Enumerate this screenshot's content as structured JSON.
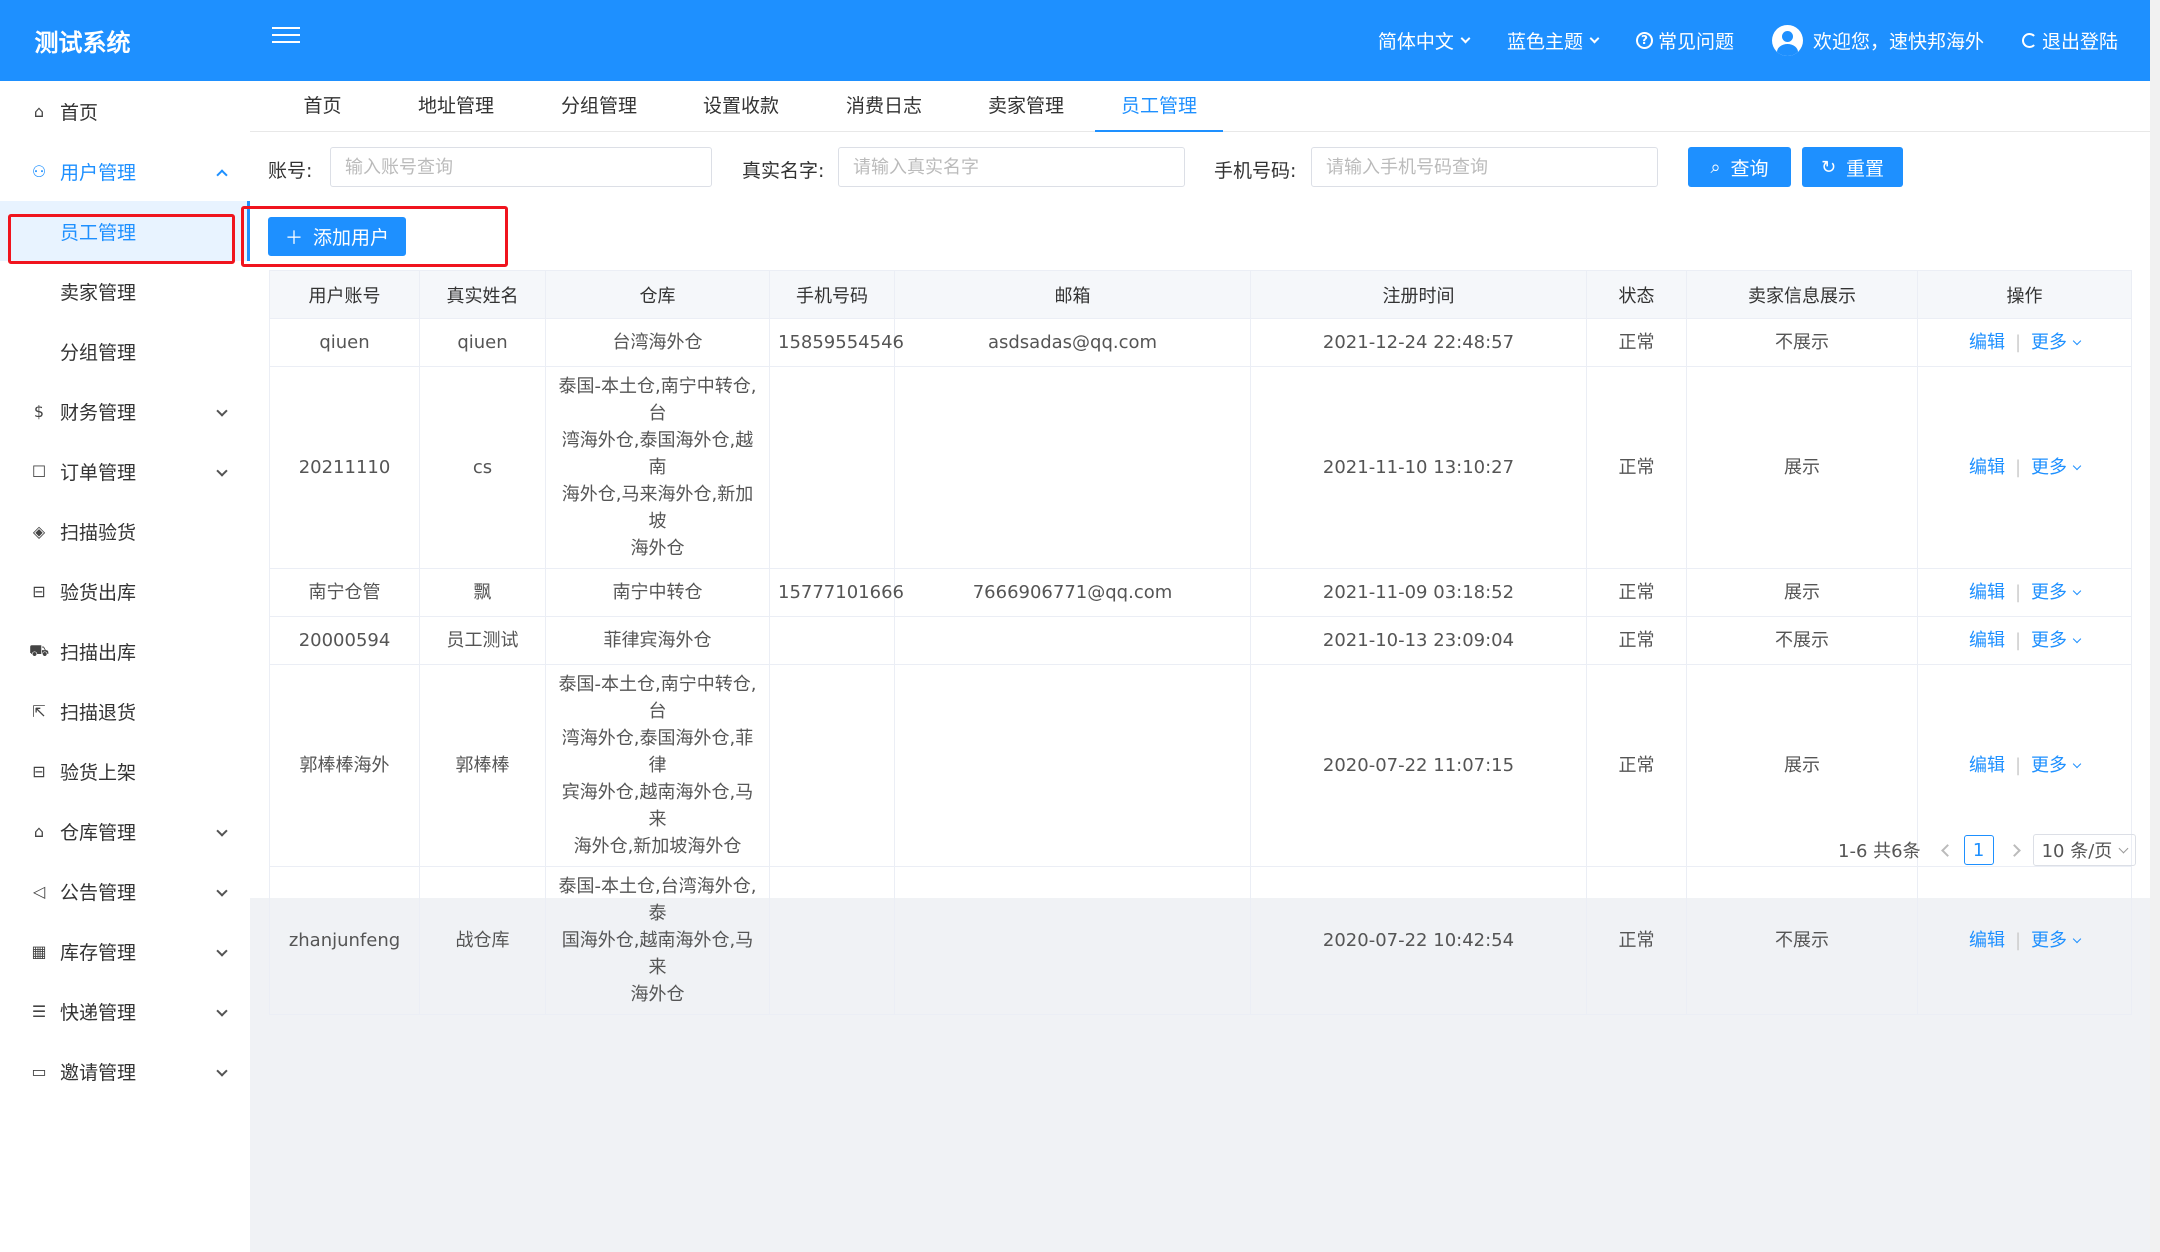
{
  "app": {
    "title": "测试系统"
  },
  "header": {
    "language": "简体中文",
    "theme": "蓝色主题",
    "faq": "常见问题",
    "welcome": "欢迎您，速快邦海外",
    "logout": "退出登陆"
  },
  "sidebar": {
    "home": "首页",
    "user_mgmt": "用户管理",
    "sub": [
      "员工管理",
      "卖家管理",
      "分组管理"
    ],
    "items": [
      "财务管理",
      "订单管理",
      "扫描验货",
      "验货出库",
      "扫描出库",
      "扫描退货",
      "验货上架",
      "仓库管理",
      "公告管理",
      "库存管理",
      "快递管理",
      "邀请管理"
    ]
  },
  "tabs": [
    "首页",
    "地址管理",
    "分组管理",
    "设置收款",
    "消费日志",
    "卖家管理",
    "员工管理"
  ],
  "filters": {
    "account_label": "账号:",
    "account_placeholder": "输入账号查询",
    "name_label": "真实名字:",
    "name_placeholder": "请输入真实名字",
    "phone_label": "手机号码:",
    "phone_placeholder": "请输入手机号码查询",
    "search": "查询",
    "reset": "重置"
  },
  "add_user": "添加用户",
  "table": {
    "headers": [
      "用户账号",
      "真实姓名",
      "仓库",
      "手机号码",
      "邮箱",
      "注册时间",
      "状态",
      "卖家信息展示",
      "操作"
    ],
    "rows": [
      {
        "account": "qiuen",
        "name": "qiuen",
        "wh": [
          "台湾海外仓"
        ],
        "phone": "15859554546",
        "email": "asdsadas@qq.com",
        "time": "2021-12-24 22:48:57",
        "status": "正常",
        "show": "不展示"
      },
      {
        "account": "20211110",
        "name": "cs",
        "wh": [
          "泰国-本土仓,南宁中转仓,台",
          "湾海外仓,泰国海外仓,越南",
          "海外仓,马来海外仓,新加坡",
          "海外仓"
        ],
        "phone": "",
        "email": "",
        "time": "2021-11-10 13:10:27",
        "status": "正常",
        "show": "展示"
      },
      {
        "account": "南宁仓管",
        "name": "飘",
        "wh": [
          "南宁中转仓"
        ],
        "phone": "15777101666",
        "email": "7666906771@qq.com",
        "time": "2021-11-09 03:18:52",
        "status": "正常",
        "show": "展示"
      },
      {
        "account": "20000594",
        "name": "员工测试",
        "wh": [
          "菲律宾海外仓"
        ],
        "phone": "",
        "email": "",
        "time": "2021-10-13 23:09:04",
        "status": "正常",
        "show": "不展示"
      },
      {
        "account": "郭棒棒海外",
        "name": "郭棒棒",
        "wh": [
          "泰国-本土仓,南宁中转仓,台",
          "湾海外仓,泰国海外仓,菲律",
          "宾海外仓,越南海外仓,马来",
          "海外仓,新加坡海外仓"
        ],
        "phone": "",
        "email": "",
        "time": "2020-07-22 11:07:15",
        "status": "正常",
        "show": "展示"
      },
      {
        "account": "zhanjunfeng",
        "name": "战仓库",
        "wh": [
          "泰国-本土仓,台湾海外仓,泰",
          "国海外仓,越南海外仓,马来",
          "海外仓"
        ],
        "phone": "",
        "email": "",
        "time": "2020-07-22 10:42:54",
        "status": "正常",
        "show": "不展示"
      }
    ],
    "edit": "编辑",
    "more": "更多"
  },
  "pager": {
    "summary": "1-6 共6条",
    "page": "1",
    "size": "10 条/页"
  },
  "colors": {
    "primary": "#1e90ff",
    "highlight": "#f0141e"
  }
}
